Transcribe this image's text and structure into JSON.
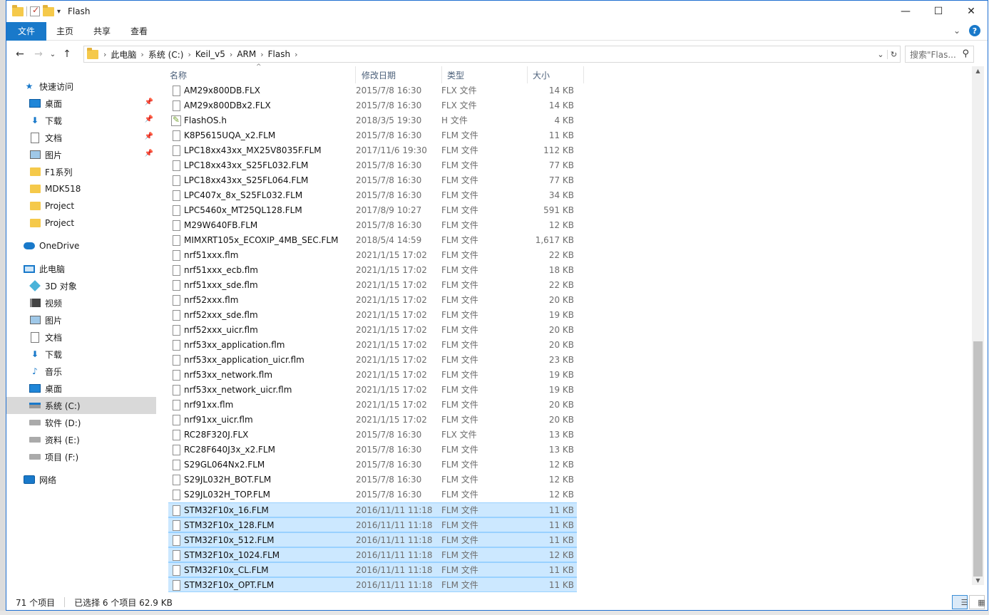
{
  "window": {
    "title": "Flash",
    "controls": {
      "minimize": "—",
      "maximize": "☐",
      "close": "✕"
    }
  },
  "ribbon": {
    "tabs": [
      "文件",
      "主页",
      "共享",
      "查看"
    ],
    "active_tab": "文件",
    "collapse_glyph": "⌄",
    "help_glyph": "?"
  },
  "navigation": {
    "back": "←",
    "forward": "→",
    "recent": "⌄",
    "up": "↑",
    "breadcrumb": [
      "此电脑",
      "系统 (C:)",
      "Keil_v5",
      "ARM",
      "Flash"
    ],
    "crumb_separator": "›",
    "dropdown_glyph": "⌄",
    "refresh_glyph": "↻",
    "search_placeholder": "搜索\"Flas...",
    "search_glyph": "⚲"
  },
  "sidebar": {
    "items": [
      {
        "label": "快速访问",
        "icon": "star-icon",
        "pinned": false
      },
      {
        "label": "桌面",
        "icon": "desktop-icon",
        "pinned": true
      },
      {
        "label": "下载",
        "icon": "download-icon",
        "pinned": true
      },
      {
        "label": "文档",
        "icon": "document-icon",
        "pinned": true
      },
      {
        "label": "图片",
        "icon": "picture-icon",
        "pinned": true
      },
      {
        "label": "F1系列",
        "icon": "folder-icon",
        "pinned": false
      },
      {
        "label": "MDK518",
        "icon": "folder-icon",
        "pinned": false
      },
      {
        "label": "Project",
        "icon": "folder-icon",
        "pinned": false
      },
      {
        "label": "Project",
        "icon": "folder-icon",
        "pinned": false
      },
      {
        "label": "OneDrive",
        "icon": "cloud-icon",
        "pinned": false
      },
      {
        "label": "此电脑",
        "icon": "computer-icon",
        "pinned": false
      },
      {
        "label": "3D 对象",
        "icon": "3d-objects-icon",
        "pinned": false
      },
      {
        "label": "视频",
        "icon": "video-icon",
        "pinned": false
      },
      {
        "label": "图片",
        "icon": "picture-icon",
        "pinned": false
      },
      {
        "label": "文档",
        "icon": "document-icon",
        "pinned": false
      },
      {
        "label": "下载",
        "icon": "download-icon",
        "pinned": false
      },
      {
        "label": "音乐",
        "icon": "music-icon",
        "pinned": false
      },
      {
        "label": "桌面",
        "icon": "desktop-icon",
        "pinned": false
      },
      {
        "label": "系统 (C:)",
        "icon": "system-drive-icon",
        "pinned": false,
        "selected": true
      },
      {
        "label": "软件 (D:)",
        "icon": "drive-icon",
        "pinned": false
      },
      {
        "label": "资料 (E:)",
        "icon": "drive-icon",
        "pinned": false
      },
      {
        "label": "项目 (F:)",
        "icon": "drive-icon",
        "pinned": false
      },
      {
        "label": "网络",
        "icon": "network-icon",
        "pinned": false
      }
    ],
    "pin_glyph": "📌"
  },
  "file_list": {
    "columns": {
      "name": "名称",
      "date": "修改日期",
      "type": "类型",
      "size": "大小"
    },
    "sort_glyph": "^",
    "rows": [
      {
        "name": "AM29x800DB.FLX",
        "date": "2015/7/8 16:30",
        "type": "FLX 文件",
        "size": "14 KB"
      },
      {
        "name": "AM29x800DBx2.FLX",
        "date": "2015/7/8 16:30",
        "type": "FLX 文件",
        "size": "14 KB"
      },
      {
        "name": "FlashOS.h",
        "date": "2018/3/5 19:30",
        "type": "H 文件",
        "size": "4 KB",
        "icon": "header-file-icon"
      },
      {
        "name": "K8P5615UQA_x2.FLM",
        "date": "2015/7/8 16:30",
        "type": "FLM 文件",
        "size": "11 KB"
      },
      {
        "name": "LPC18xx43xx_MX25V8035F.FLM",
        "date": "2017/11/6 19:30",
        "type": "FLM 文件",
        "size": "112 KB"
      },
      {
        "name": "LPC18xx43xx_S25FL032.FLM",
        "date": "2015/7/8 16:30",
        "type": "FLM 文件",
        "size": "77 KB"
      },
      {
        "name": "LPC18xx43xx_S25FL064.FLM",
        "date": "2015/7/8 16:30",
        "type": "FLM 文件",
        "size": "77 KB"
      },
      {
        "name": "LPC407x_8x_S25FL032.FLM",
        "date": "2015/7/8 16:30",
        "type": "FLM 文件",
        "size": "34 KB"
      },
      {
        "name": "LPC5460x_MT25QL128.FLM",
        "date": "2017/8/9 10:27",
        "type": "FLM 文件",
        "size": "591 KB"
      },
      {
        "name": "M29W640FB.FLM",
        "date": "2015/7/8 16:30",
        "type": "FLM 文件",
        "size": "12 KB"
      },
      {
        "name": "MIMXRT105x_ECOXIP_4MB_SEC.FLM",
        "date": "2018/5/4 14:59",
        "type": "FLM 文件",
        "size": "1,617 KB"
      },
      {
        "name": "nrf51xxx.flm",
        "date": "2021/1/15 17:02",
        "type": "FLM 文件",
        "size": "22 KB"
      },
      {
        "name": "nrf51xxx_ecb.flm",
        "date": "2021/1/15 17:02",
        "type": "FLM 文件",
        "size": "18 KB"
      },
      {
        "name": "nrf51xxx_sde.flm",
        "date": "2021/1/15 17:02",
        "type": "FLM 文件",
        "size": "22 KB"
      },
      {
        "name": "nrf52xxx.flm",
        "date": "2021/1/15 17:02",
        "type": "FLM 文件",
        "size": "20 KB"
      },
      {
        "name": "nrf52xxx_sde.flm",
        "date": "2021/1/15 17:02",
        "type": "FLM 文件",
        "size": "19 KB"
      },
      {
        "name": "nrf52xxx_uicr.flm",
        "date": "2021/1/15 17:02",
        "type": "FLM 文件",
        "size": "20 KB"
      },
      {
        "name": "nrf53xx_application.flm",
        "date": "2021/1/15 17:02",
        "type": "FLM 文件",
        "size": "20 KB"
      },
      {
        "name": "nrf53xx_application_uicr.flm",
        "date": "2021/1/15 17:02",
        "type": "FLM 文件",
        "size": "23 KB"
      },
      {
        "name": "nrf53xx_network.flm",
        "date": "2021/1/15 17:02",
        "type": "FLM 文件",
        "size": "19 KB"
      },
      {
        "name": "nrf53xx_network_uicr.flm",
        "date": "2021/1/15 17:02",
        "type": "FLM 文件",
        "size": "19 KB"
      },
      {
        "name": "nrf91xx.flm",
        "date": "2021/1/15 17:02",
        "type": "FLM 文件",
        "size": "20 KB"
      },
      {
        "name": "nrf91xx_uicr.flm",
        "date": "2021/1/15 17:02",
        "type": "FLM 文件",
        "size": "20 KB"
      },
      {
        "name": "RC28F320J.FLX",
        "date": "2015/7/8 16:30",
        "type": "FLX 文件",
        "size": "13 KB"
      },
      {
        "name": "RC28F640J3x_x2.FLM",
        "date": "2015/7/8 16:30",
        "type": "FLM 文件",
        "size": "13 KB"
      },
      {
        "name": "S29GL064Nx2.FLM",
        "date": "2015/7/8 16:30",
        "type": "FLM 文件",
        "size": "12 KB"
      },
      {
        "name": "S29JL032H_BOT.FLM",
        "date": "2015/7/8 16:30",
        "type": "FLM 文件",
        "size": "12 KB"
      },
      {
        "name": "S29JL032H_TOP.FLM",
        "date": "2015/7/8 16:30",
        "type": "FLM 文件",
        "size": "12 KB"
      },
      {
        "name": "STM32F10x_16.FLM",
        "date": "2016/11/11 11:18",
        "type": "FLM 文件",
        "size": "11 KB",
        "selected": true
      },
      {
        "name": "STM32F10x_128.FLM",
        "date": "2016/11/11 11:18",
        "type": "FLM 文件",
        "size": "11 KB",
        "selected": true
      },
      {
        "name": "STM32F10x_512.FLM",
        "date": "2016/11/11 11:18",
        "type": "FLM 文件",
        "size": "11 KB",
        "selected": true
      },
      {
        "name": "STM32F10x_1024.FLM",
        "date": "2016/11/11 11:18",
        "type": "FLM 文件",
        "size": "12 KB",
        "selected": true
      },
      {
        "name": "STM32F10x_CL.FLM",
        "date": "2016/11/11 11:18",
        "type": "FLM 文件",
        "size": "11 KB",
        "selected": true
      },
      {
        "name": "STM32F10x_OPT.FLM",
        "date": "2016/11/11 11:18",
        "type": "FLM 文件",
        "size": "11 KB",
        "selected": true
      }
    ]
  },
  "scrollbar": {
    "up": "▲",
    "down": "▼",
    "position": 0.53
  },
  "status": {
    "item_count": "71 个项目",
    "selection": "已选择 6 个项目 62.9 KB",
    "details_view_glyph": "☰",
    "tiles_view_glyph": "▦"
  },
  "colors": {
    "accent": "#1979ca",
    "selection_bg": "#cce8ff",
    "selection_border": "#99d1ff",
    "folder": "#f5c94a"
  }
}
